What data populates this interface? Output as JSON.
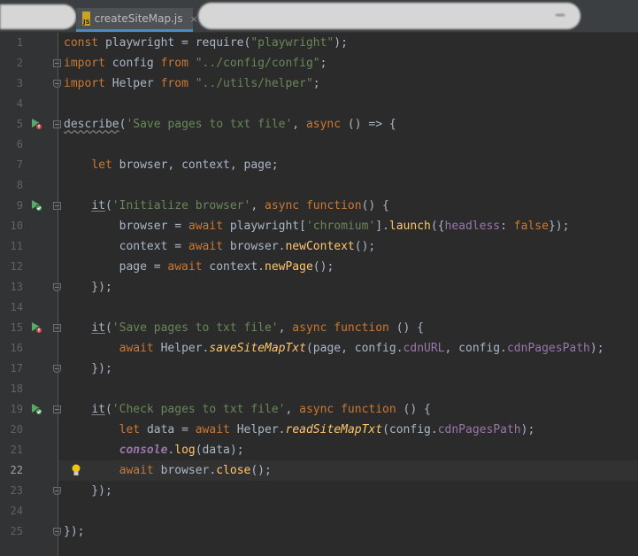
{
  "tab": {
    "filename": "createSiteMap.js",
    "icon_label": "JS",
    "close_glyph": "×"
  },
  "line_numbers": [
    "1",
    "2",
    "3",
    "4",
    "5",
    "6",
    "7",
    "8",
    "9",
    "10",
    "11",
    "12",
    "13",
    "14",
    "15",
    "16",
    "17",
    "18",
    "19",
    "20",
    "21",
    "22",
    "23",
    "24",
    "25"
  ],
  "current_line": "22",
  "colors": {
    "background": "#2b2b2b",
    "gutter": "#313335",
    "keyword": "#cc7832",
    "string": "#6a8759",
    "function": "#ffc66d",
    "property": "#9876aa",
    "text": "#a9b7c6",
    "run_icon": "#59a869",
    "run_icon_failed": "#c75450"
  },
  "code": [
    [
      [
        "kw",
        "const "
      ],
      [
        "t",
        "playwright = require("
      ],
      [
        "str",
        "\"playwright\""
      ],
      [
        "t",
        ");"
      ]
    ],
    [
      [
        "kw",
        "import "
      ],
      [
        "t",
        "config "
      ],
      [
        "kw",
        "from "
      ],
      [
        "str",
        "\"../config/config\""
      ],
      [
        "t",
        ";"
      ]
    ],
    [
      [
        "kw",
        "import "
      ],
      [
        "t",
        "Helper "
      ],
      [
        "kw",
        "from "
      ],
      [
        "str",
        "\"../utils/helper\""
      ],
      [
        "t",
        ";"
      ]
    ],
    [],
    [
      [
        "wavy",
        "describe"
      ],
      [
        "t",
        "("
      ],
      [
        "str",
        "'Save pages to txt file'"
      ],
      [
        "t",
        ", "
      ],
      [
        "kw",
        "async "
      ],
      [
        "t",
        "() => {"
      ]
    ],
    [],
    [
      [
        "t",
        "    "
      ],
      [
        "kw",
        "let "
      ],
      [
        "t",
        "browser, context, page;"
      ]
    ],
    [],
    [
      [
        "t",
        "    "
      ],
      [
        "ul",
        "it"
      ],
      [
        "t",
        "("
      ],
      [
        "str",
        "'Initialize browser'"
      ],
      [
        "t",
        ", "
      ],
      [
        "kw",
        "async function"
      ],
      [
        "t",
        "() {"
      ]
    ],
    [
      [
        "t",
        "        browser = "
      ],
      [
        "kw",
        "await "
      ],
      [
        "t",
        "playwright["
      ],
      [
        "str",
        "'chromium'"
      ],
      [
        "t",
        "]."
      ],
      [
        "fn",
        "launch"
      ],
      [
        "t",
        "({"
      ],
      [
        "prop",
        "headless"
      ],
      [
        "t",
        ": "
      ],
      [
        "kw",
        "false"
      ],
      [
        "t",
        "});"
      ]
    ],
    [
      [
        "t",
        "        context = "
      ],
      [
        "kw",
        "await "
      ],
      [
        "t",
        "browser."
      ],
      [
        "fn",
        "newContext"
      ],
      [
        "t",
        "();"
      ]
    ],
    [
      [
        "t",
        "        page = "
      ],
      [
        "kw",
        "await "
      ],
      [
        "t",
        "context."
      ],
      [
        "fn",
        "newPage"
      ],
      [
        "t",
        "();"
      ]
    ],
    [
      [
        "t",
        "    });"
      ]
    ],
    [],
    [
      [
        "t",
        "    "
      ],
      [
        "ul",
        "it"
      ],
      [
        "t",
        "("
      ],
      [
        "str",
        "'Save pages to txt file'"
      ],
      [
        "t",
        ", "
      ],
      [
        "kw",
        "async function "
      ],
      [
        "t",
        "() {"
      ]
    ],
    [
      [
        "t",
        "        "
      ],
      [
        "kw",
        "await "
      ],
      [
        "t",
        "Helper."
      ],
      [
        "it",
        "saveSiteMapTxt"
      ],
      [
        "t",
        "(page, config."
      ],
      [
        "prop",
        "cdnURL"
      ],
      [
        "t",
        ", config."
      ],
      [
        "prop",
        "cdnPagesPath"
      ],
      [
        "t",
        ");"
      ]
    ],
    [
      [
        "t",
        "    });"
      ]
    ],
    [],
    [
      [
        "t",
        "    "
      ],
      [
        "ul",
        "it"
      ],
      [
        "t",
        "("
      ],
      [
        "str",
        "'Check pages to txt file'"
      ],
      [
        "t",
        ", "
      ],
      [
        "kw",
        "async function "
      ],
      [
        "t",
        "() {"
      ]
    ],
    [
      [
        "t",
        "        "
      ],
      [
        "kw",
        "let "
      ],
      [
        "t",
        "data = "
      ],
      [
        "kw",
        "await "
      ],
      [
        "t",
        "Helper."
      ],
      [
        "it",
        "readSiteMapTxt"
      ],
      [
        "t",
        "(config."
      ],
      [
        "prop",
        "cdnPagesPath"
      ],
      [
        "t",
        ");"
      ]
    ],
    [
      [
        "t",
        "        "
      ],
      [
        "cons",
        "console"
      ],
      [
        "t",
        "."
      ],
      [
        "fn",
        "log"
      ],
      [
        "t",
        "(data);"
      ]
    ],
    [
      [
        "t",
        "        "
      ],
      [
        "kw",
        "await "
      ],
      [
        "t",
        "browser."
      ],
      [
        "fn",
        "close"
      ],
      [
        "t",
        "();"
      ]
    ],
    [
      [
        "t",
        "    });"
      ]
    ],
    [],
    [
      [
        "t",
        "});"
      ]
    ]
  ],
  "gutter_icons": [
    {
      "line": "5",
      "icon": "run-failed-icon"
    },
    {
      "line": "9",
      "icon": "run-passed-icon"
    },
    {
      "line": "15",
      "icon": "run-failed-icon"
    },
    {
      "line": "19",
      "icon": "run-passed-icon"
    }
  ],
  "bulb": {
    "line": "22",
    "icon": "lightbulb-icon"
  }
}
